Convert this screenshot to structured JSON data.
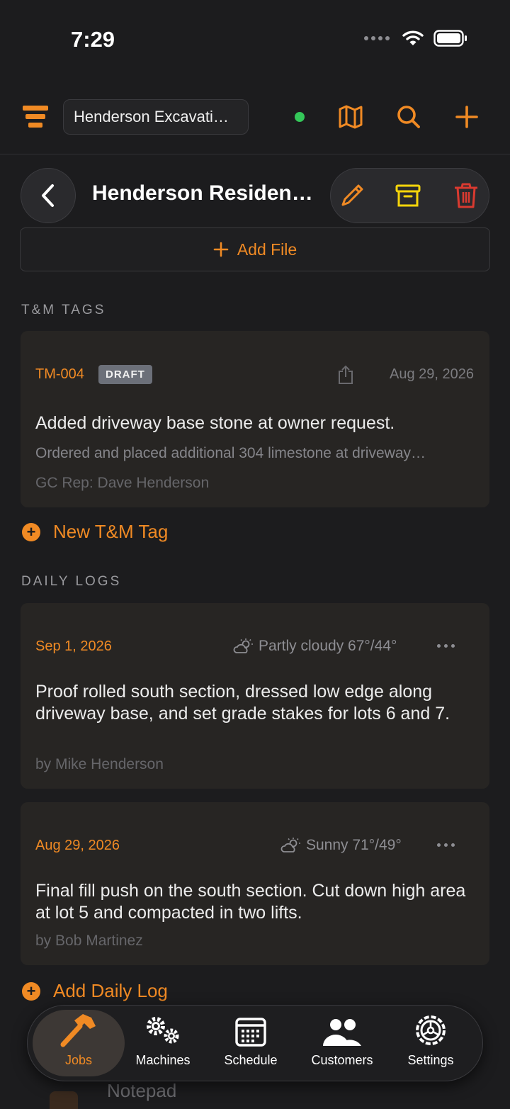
{
  "status_bar": {
    "time": "7:29"
  },
  "header": {
    "company": "Henderson Excavati…"
  },
  "title_bar": {
    "title": "Henderson Residen…"
  },
  "files": {
    "add_label": "Add File"
  },
  "tm_tags": {
    "section_label": "T&M TAGS",
    "items": [
      {
        "id": "TM-004",
        "status": "DRAFT",
        "date": "Aug 29, 2026",
        "title": "Added driveway base stone at owner request.",
        "description": "Ordered and placed additional 304 limestone at driveway…",
        "rep": "GC Rep: Dave Henderson"
      }
    ],
    "new_label": "New T&M Tag"
  },
  "daily_logs": {
    "section_label": "DAILY LOGS",
    "items": [
      {
        "date": "Sep 1, 2026",
        "weather_icon": "partly-cloudy-icon",
        "weather": "Partly cloudy 67°/44°",
        "text": "Proof rolled south section, dressed low edge along driveway base, and set grade stakes for lots 6 and 7.",
        "author": "by Mike Henderson"
      },
      {
        "date": "Aug 29, 2026",
        "weather_icon": "sunny-icon",
        "weather": "Sunny 71°/49°",
        "text": "Final fill push on the south section. Cut down high area at lot 5 and compacted in two lifts.",
        "author": "by Bob Martinez"
      }
    ],
    "add_label": "Add Daily Log"
  },
  "notepad": {
    "label": "Notepad"
  },
  "tabbar": {
    "tabs": [
      {
        "label": "Jobs",
        "icon": "hammer-icon",
        "active": true
      },
      {
        "label": "Machines",
        "icon": "gears-icon",
        "active": false
      },
      {
        "label": "Schedule",
        "icon": "calendar-icon",
        "active": false
      },
      {
        "label": "Customers",
        "icon": "people-icon",
        "active": false
      },
      {
        "label": "Settings",
        "icon": "gear-icon",
        "active": false
      }
    ]
  },
  "colors": {
    "accent": "#f08a24",
    "background": "#1c1c1e",
    "card": "#272523",
    "online": "#34c759",
    "archive": "#f5d50a",
    "delete": "#d93a30"
  }
}
